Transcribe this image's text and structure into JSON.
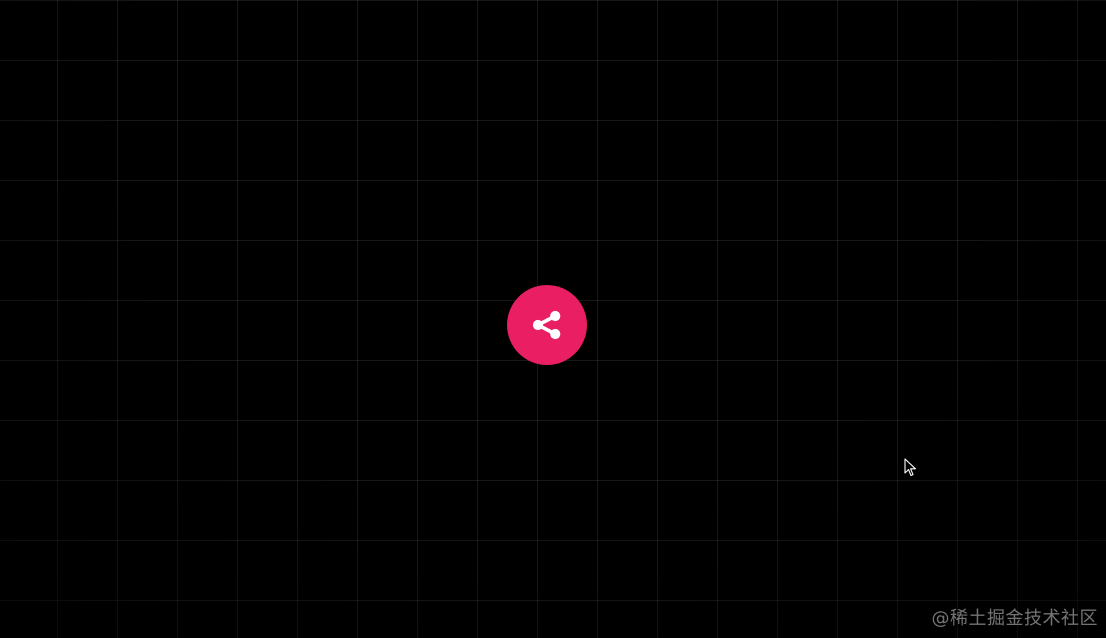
{
  "theme": {
    "background": "#000000",
    "accent": "#e91e63",
    "icon_color": "#ffffff"
  },
  "share_button": {
    "icon": "share-icon"
  },
  "cursor": {
    "icon": "mouse-pointer-icon"
  },
  "watermark": {
    "text": "@稀土掘金技术社区"
  }
}
